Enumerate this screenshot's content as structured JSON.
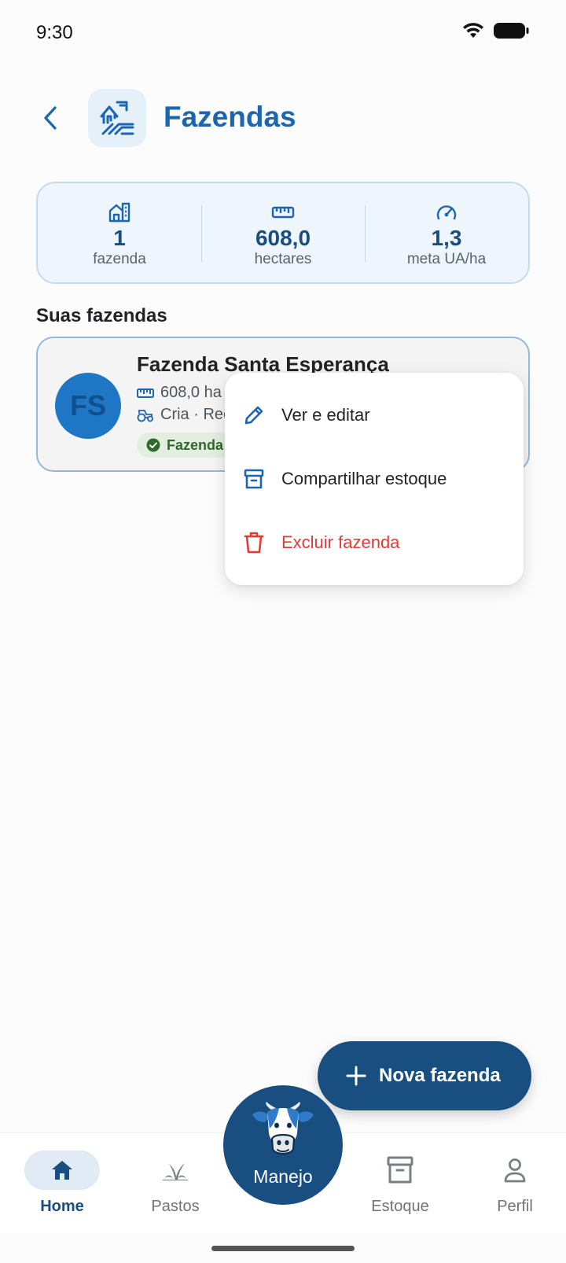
{
  "status_bar": {
    "time": "9:30"
  },
  "header": {
    "title": "Fazendas"
  },
  "stats": [
    {
      "icon": "farm-building-icon",
      "value": "1",
      "label": "fazenda"
    },
    {
      "icon": "ruler-icon",
      "value": "608,0",
      "label": "hectares"
    },
    {
      "icon": "gauge-icon",
      "value": "1,3",
      "label": "meta UA/ha"
    }
  ],
  "section_title": "Suas fazendas",
  "farm": {
    "initials": "FS",
    "name": "Fazenda Santa Esperança",
    "area": "608,0 ha",
    "activity": "Cria · Rec",
    "badge": "Fazenda"
  },
  "menu": {
    "items": [
      {
        "label": "Ver e editar",
        "icon": "pencil-icon",
        "color": "#1B66AE"
      },
      {
        "label": "Compartilhar estoque",
        "icon": "archive-icon",
        "color": "#1B66AE"
      },
      {
        "label": "Excluir fazenda",
        "icon": "trash-icon",
        "color": "#E23B36"
      }
    ]
  },
  "fab": {
    "label": "Nova fazenda"
  },
  "bottom_nav": {
    "items": [
      {
        "label": "Home",
        "icon": "home-icon",
        "active": true
      },
      {
        "label": "Pastos",
        "icon": "grass-icon",
        "active": false
      },
      {
        "label": "Estoque",
        "icon": "archive-icon",
        "active": false
      },
      {
        "label": "Perfil",
        "icon": "person-icon",
        "active": false
      }
    ],
    "center": {
      "label": "Manejo",
      "icon": "cow-icon"
    }
  },
  "colors": {
    "primary": "#184E80",
    "accent": "#1B66AE",
    "danger": "#E23B36",
    "success": "#2D6A2B"
  }
}
